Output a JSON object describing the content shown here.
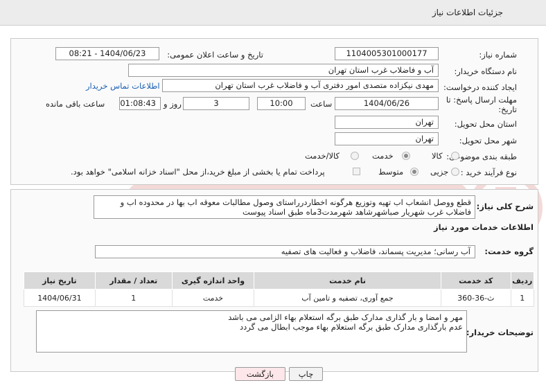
{
  "header": {
    "title": "جزئیات اطلاعات نیاز"
  },
  "form": {
    "need_number_label": "شماره نیاز:",
    "need_number": "1104005301000177",
    "announce_label": "تاریخ و ساعت اعلان عمومی:",
    "announce_value": "1404/06/23 - 08:21",
    "buyer_org_label": "نام دستگاه خریدار:",
    "buyer_org": "آب و فاضلاب غرب استان تهران",
    "creator_label": "ایجاد کننده درخواست:",
    "creator": "مهدی نیکزاده متصدی امور دفتری آب و فاضلاب غرب استان تهران",
    "contact_link": "اطلاعات تماس خریدار",
    "deadline_label_1": "مهلت ارسال پاسخ: تا",
    "deadline_label_2": "تاریخ:",
    "deadline_date": "1404/06/26",
    "time_label": "ساعت",
    "deadline_time": "10:00",
    "days_value": "3",
    "days_label": "روز و",
    "remaining_time": "01:08:43",
    "remaining_label": "ساعت باقی مانده",
    "province_label": "استان محل تحویل:",
    "province": "تهران",
    "city_label": "شهر محل تحویل:",
    "city": "تهران",
    "category_label": "طبقه بندی موضوعی:",
    "category_options": [
      "کالا",
      "خدمت",
      "کالا/خدمت"
    ],
    "category_selected": "خدمت",
    "process_label": "نوع فرآیند خرید :",
    "process_options": [
      "جزیی",
      "متوسط"
    ],
    "process_selected": "متوسط",
    "payment_note": "پرداخت تمام یا بخشی از مبلغ خرید،از محل \"اسناد خزانه اسلامی\" خواهد بود."
  },
  "description": {
    "label": "شرح کلی نیاز:",
    "text": "قطع  ووصل انشعاب اب تهیه وتوزیع هرگونه اخطاردرراستای وصول مطالبات معوقه اب بها در محدوده اب و فاضلاب غرب شهریار صباشهرشاهد شهرمدت3ماه طبق اسناد پیوست"
  },
  "services": {
    "section_title": "اطلاعات خدمات مورد نیاز",
    "group_label": "گروه خدمت:",
    "group_value": "آب رسانی؛ مدیریت پسماند، فاضلاب و فعالیت های تصفیه",
    "columns": [
      "ردیف",
      "کد خدمت",
      "نام خدمت",
      "واحد اندازه گیری",
      "تعداد / مقدار",
      "تاریخ نیاز"
    ],
    "rows": [
      [
        "1",
        "ث-36-360",
        "جمع آوری، تصفیه و تامین آب",
        "خدمت",
        "1",
        "1404/06/31"
      ]
    ]
  },
  "buyer_notes": {
    "label": "توضیحات خریدار:",
    "lines": [
      "مهر و امضا و بار گذاری مدارک طبق برگه استعلام بهاء الزامی می باشد",
      "عدم بارگذاری مدارک طبق برگه استعلام بهاء موجب ابطال می گردد"
    ]
  },
  "buttons": {
    "print": "چاپ",
    "back": "بازگشت"
  },
  "colors": {
    "header_bg": "#ececec",
    "link": "#1a5fb4",
    "back_button_bg": "#fde7ea",
    "table_header_bg": "#d9d9d9"
  }
}
